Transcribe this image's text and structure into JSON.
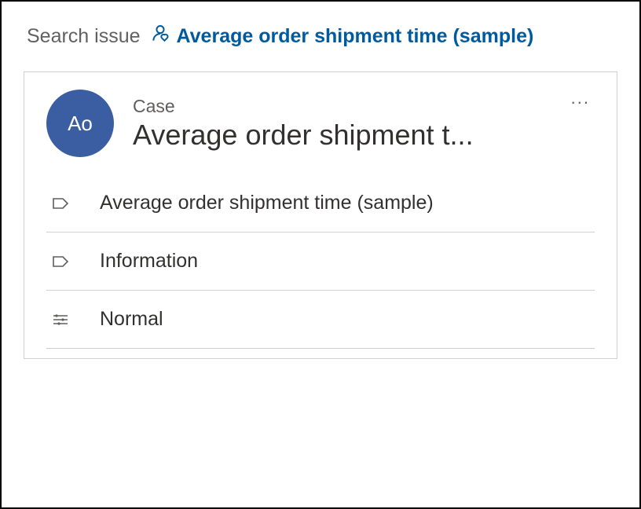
{
  "breadcrumb": {
    "label": "Search issue",
    "link_text": "Average order shipment time (sample)"
  },
  "card": {
    "avatar_initials": "Ao",
    "subtitle": "Case",
    "title": "Average order shipment t...",
    "more_label": "..."
  },
  "fields": {
    "name": "Average order shipment time (sample)",
    "form": "Information",
    "priority": "Normal"
  },
  "colors": {
    "avatar_bg": "#3b5da1",
    "link": "#005a9e",
    "muted": "#605e5c",
    "text": "#323130",
    "border": "#d2d0ce"
  }
}
